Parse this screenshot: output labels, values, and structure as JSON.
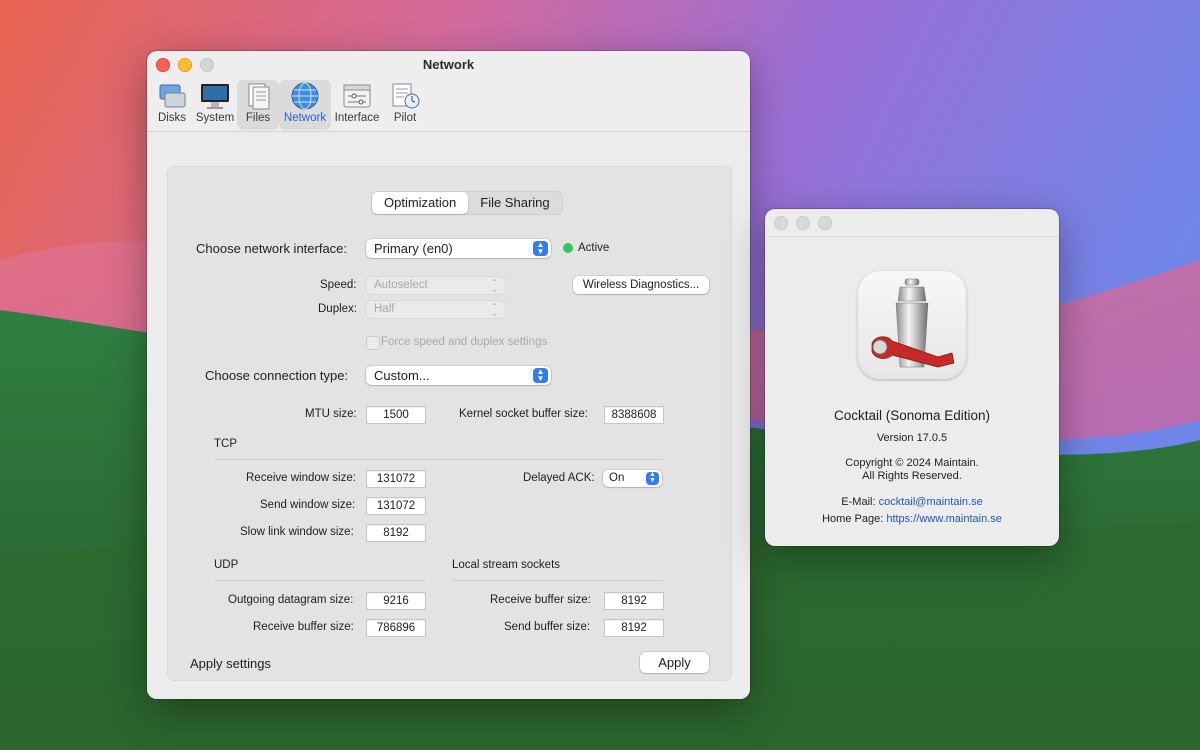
{
  "main_window": {
    "title": "Network",
    "toolbar": [
      {
        "label": "Disks",
        "icon": "disks-icon"
      },
      {
        "label": "System",
        "icon": "system-icon"
      },
      {
        "label": "Files",
        "icon": "files-icon"
      },
      {
        "label": "Network",
        "icon": "network-globe-icon",
        "active": true
      },
      {
        "label": "Interface",
        "icon": "interface-icon"
      },
      {
        "label": "Pilot",
        "icon": "pilot-icon"
      }
    ],
    "tabs": [
      "Optimization",
      "File Sharing"
    ],
    "selected_tab": "Optimization",
    "interface": {
      "label": "Choose network interface:",
      "value": "Primary (en0)",
      "status": "Active",
      "status_color": "#35c759"
    },
    "speed": {
      "label": "Speed:",
      "value": "Autoselect"
    },
    "duplex": {
      "label": "Duplex:",
      "value": "Half"
    },
    "wireless_button": "Wireless Diagnostics...",
    "force_checkbox": "Force speed and duplex settings",
    "connection": {
      "label": "Choose connection type:",
      "value": "Custom..."
    },
    "mtu": {
      "label": "MTU size:",
      "value": "1500"
    },
    "kernel_buffer": {
      "label": "Kernel socket buffer size:",
      "value": "8388608"
    },
    "tcp": {
      "heading": "TCP",
      "receive_window": {
        "label": "Receive window size:",
        "value": "131072"
      },
      "send_window": {
        "label": "Send window size:",
        "value": "131072"
      },
      "slow_link": {
        "label": "Slow link window size:",
        "value": "8192"
      },
      "delayed_ack": {
        "label": "Delayed ACK:",
        "value": "On"
      }
    },
    "udp": {
      "heading": "UDP",
      "outgoing_datagram": {
        "label": "Outgoing datagram size:",
        "value": "9216"
      },
      "receive_buffer": {
        "label": "Receive buffer size:",
        "value": "786896"
      }
    },
    "local_stream": {
      "heading": "Local stream sockets",
      "receive_buffer": {
        "label": "Receive buffer size:",
        "value": "8192"
      },
      "send_buffer": {
        "label": "Send buffer size:",
        "value": "8192"
      }
    },
    "apply_label": "Apply settings",
    "apply_button": "Apply"
  },
  "about_window": {
    "app_name": "Cocktail (Sonoma Edition)",
    "version": "Version 17.0.5",
    "copyright": "Copyright © 2024 Maintain.",
    "rights": "All Rights Reserved.",
    "email_label": "E-Mail:",
    "email": "cocktail@maintain.se",
    "homepage_label": "Home Page:",
    "homepage": "https://www.maintain.se"
  },
  "colors": {
    "accent": "#2f7df6",
    "link": "#2153c9",
    "active_tab_text": "#2563d9"
  }
}
